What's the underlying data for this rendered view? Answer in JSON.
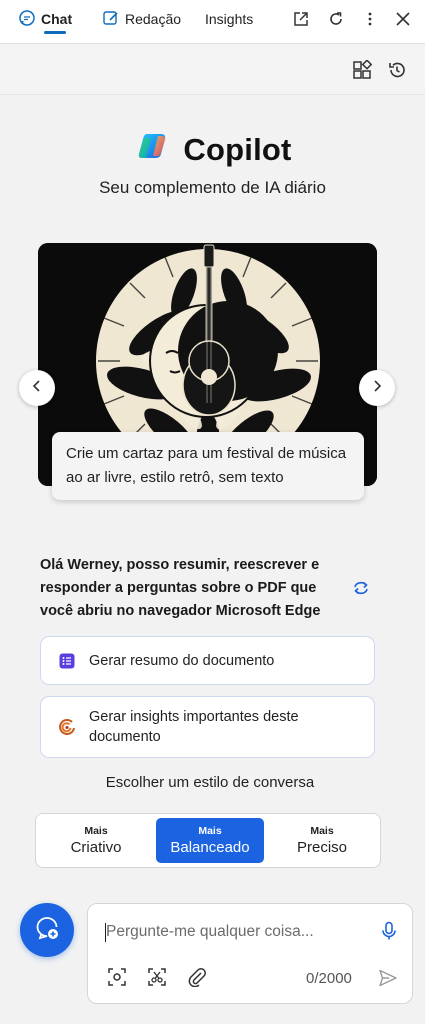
{
  "tabs": [
    {
      "label": "Chat",
      "icon": "chat-bubble-icon",
      "active": true
    },
    {
      "label": "Redação",
      "icon": "compose-icon",
      "active": false
    },
    {
      "label": "Insights",
      "active": false
    }
  ],
  "top_actions": [
    "open-in-new-window-icon",
    "refresh-icon",
    "more-options-icon",
    "close-icon"
  ],
  "toolbar_actions": [
    "plugins-icon",
    "history-icon"
  ],
  "brand": {
    "name": "Copilot",
    "subtitle": "Seu complemento de IA diário"
  },
  "carousel": {
    "caption": "Crie um cartaz para um festival de música ao ar livre, estilo retrô, sem texto",
    "prev_icon": "chevron-left-icon",
    "next_icon": "chevron-right-icon"
  },
  "greeting": "Olá Werney, posso resumir, reescrever e responder a perguntas sobre o PDF que você abriu no navegador Microsoft Edge",
  "suggestions": [
    {
      "label": "Gerar resumo do documento",
      "icon": "list-icon"
    },
    {
      "label": "Gerar insights importantes deste documento",
      "icon": "insights-icon"
    }
  ],
  "conversation_style": {
    "title": "Escolher um estilo de conversa",
    "options": [
      {
        "prefix": "Mais",
        "label": "Criativo",
        "selected": false
      },
      {
        "prefix": "Mais",
        "label": "Balanceado",
        "selected": true
      },
      {
        "prefix": "Mais",
        "label": "Preciso",
        "selected": false
      }
    ]
  },
  "input": {
    "placeholder": "Pergunte-me qualquer coisa...",
    "value": "",
    "counter": "0/2000"
  },
  "colors": {
    "accent": "#1b63e0",
    "tab_underline": "#0f6cbd",
    "background": "#f2f2f2"
  }
}
